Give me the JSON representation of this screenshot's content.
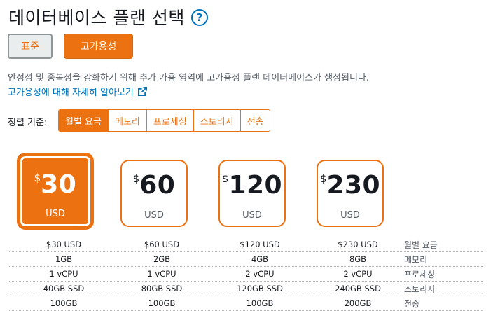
{
  "title": "데이터베이스 플랜 선택",
  "help_icon": "help-icon",
  "tiers": {
    "standard": "표준",
    "high_availability": "고가용성"
  },
  "description": "안정성 및 중복성을 강화하기 위해 추가 가용 영역에 고가용성 플랜 데이터베이스가 생성됩니다.",
  "learn_more": "고가용성에 대해 자세히 알아보기",
  "sort": {
    "label": "정렬 기준:",
    "options": [
      "월별 요금",
      "메모리",
      "프로세싱",
      "스토리지",
      "전송"
    ],
    "active": "월별 요금"
  },
  "plans": [
    {
      "symbol": "$",
      "price": "30",
      "currency": "USD",
      "selected": true
    },
    {
      "symbol": "$",
      "price": "60",
      "currency": "USD",
      "selected": false
    },
    {
      "symbol": "$",
      "price": "120",
      "currency": "USD",
      "selected": false
    },
    {
      "symbol": "$",
      "price": "230",
      "currency": "USD",
      "selected": false
    }
  ],
  "specs": {
    "rows": [
      {
        "label": "월별 요금",
        "values": [
          "$30 USD",
          "$60 USD",
          "$120 USD",
          "$230 USD"
        ]
      },
      {
        "label": "메모리",
        "values": [
          "1GB",
          "2GB",
          "4GB",
          "8GB"
        ]
      },
      {
        "label": "프로세싱",
        "values": [
          "1 vCPU",
          "1 vCPU",
          "2 vCPU",
          "2 vCPU"
        ]
      },
      {
        "label": "스토리지",
        "values": [
          "40GB SSD",
          "80GB SSD",
          "120GB SSD",
          "240GB SSD"
        ]
      },
      {
        "label": "전송",
        "values": [
          "100GB",
          "100GB",
          "100GB",
          "200GB"
        ]
      }
    ]
  },
  "colors": {
    "accent": "#ec7211",
    "link": "#0073bb",
    "text": "#16191f",
    "muted": "#545b64"
  }
}
